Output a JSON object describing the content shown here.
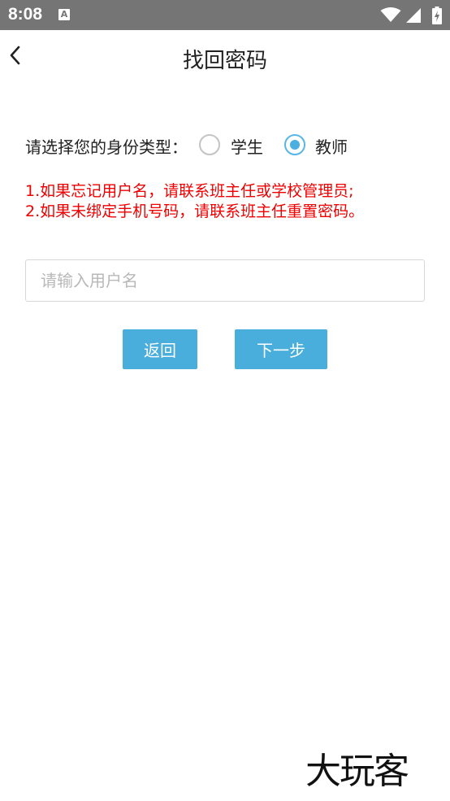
{
  "status_bar": {
    "time": "8:08",
    "notification_icon_letter": "A",
    "icons": [
      "wifi-icon",
      "signal-icon",
      "battery-icon"
    ]
  },
  "app_bar": {
    "title": "找回密码",
    "back_icon": "chevron-left-icon"
  },
  "identity": {
    "label": "请选择您的身份类型：",
    "options": [
      {
        "label": "学生",
        "selected": false
      },
      {
        "label": "教师",
        "selected": true
      }
    ]
  },
  "notice": {
    "lines": [
      "1.如果忘记用户名，请联系班主任或学校管理员;",
      "2.如果未绑定手机号码，请联系班主任重置密码。"
    ],
    "color": "#ee0000"
  },
  "username": {
    "value": "",
    "placeholder": "请输入用户名"
  },
  "buttons": {
    "back_label": "返回",
    "next_label": "下一步"
  },
  "watermark": "大玩客",
  "colors": {
    "accent": "#4aaedc",
    "status_bar": "#757575"
  }
}
